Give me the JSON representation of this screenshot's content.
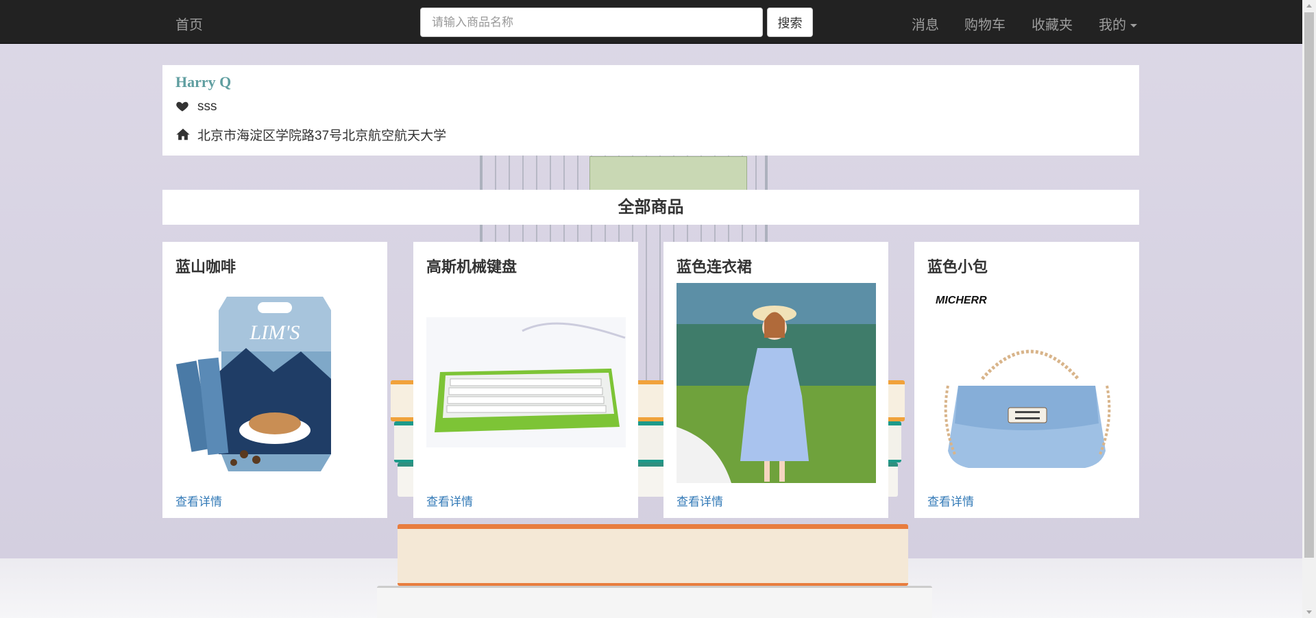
{
  "navbar": {
    "home": "首页",
    "search_placeholder": "请输入商品名称",
    "search_button": "搜索",
    "messages": "消息",
    "cart": "购物车",
    "favorites": "收藏夹",
    "mine": "我的"
  },
  "profile": {
    "name": "Harry Q",
    "signature": "sss",
    "address": "北京市海淀区学院路37号北京航空航天大学"
  },
  "section_title": "全部商品",
  "products": [
    {
      "title": "蓝山咖啡",
      "link": "查看详情",
      "brand_text": "LIM'S"
    },
    {
      "title": "高斯机械键盘",
      "link": "查看详情"
    },
    {
      "title": "蓝色连衣裙",
      "link": "查看详情"
    },
    {
      "title": "蓝色小包",
      "link": "查看详情",
      "brand_text": "MICHERR"
    }
  ],
  "colors": {
    "navbar_bg": "#222222",
    "nav_text": "#9d9d9d",
    "profile_name": "#5f9ea0",
    "link": "#337ab7"
  }
}
